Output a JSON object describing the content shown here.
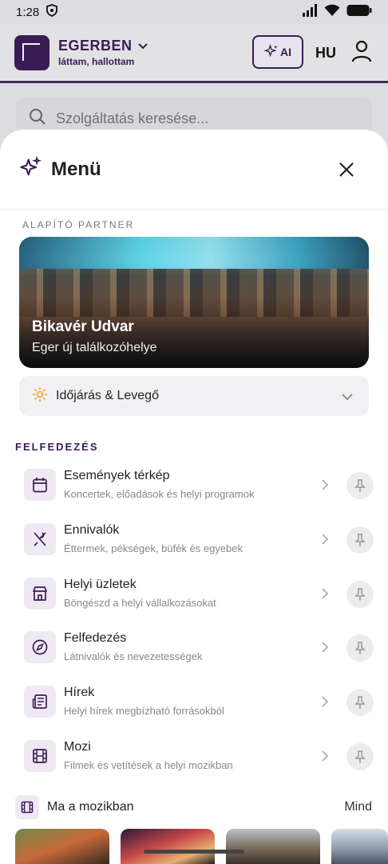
{
  "status_bar": {
    "time": "1:28"
  },
  "app_header": {
    "brand": "EGERBEN",
    "tagline": "láttam, hallottam",
    "ai_label": "AI",
    "lang": "HU"
  },
  "search": {
    "placeholder": "Szolgáltatás keresése..."
  },
  "menu": {
    "title": "Menü",
    "partner_caption": "ALAPÍTÓ PARTNER",
    "partner": {
      "name": "Bikavér Udvar",
      "subtitle": "Eger új találkozóhelye"
    },
    "weather_label": "Időjárás & Levegő",
    "explore_title": "FELFEDEZÉS",
    "items": [
      {
        "title": "Események térkép",
        "subtitle": "Koncertek, előadások és helyi programok",
        "icon": "calendar-icon"
      },
      {
        "title": "Ennivalók",
        "subtitle": "Éttermek, pékségek, büfék és egyebek",
        "icon": "utensils-icon"
      },
      {
        "title": "Helyi üzletek",
        "subtitle": "Böngészd a helyi vállalkozásokat",
        "icon": "store-icon"
      },
      {
        "title": "Felfedezés",
        "subtitle": "Látnivalók és nevezetességek",
        "icon": "compass-icon"
      },
      {
        "title": "Hírek",
        "subtitle": "Helyi hírek megbízható forrásokból",
        "icon": "newspaper-icon"
      },
      {
        "title": "Mozi",
        "subtitle": "Filmek és vetítések a helyi mozikban",
        "icon": "film-icon"
      }
    ],
    "cinema": {
      "label": "Ma a mozikban",
      "all_label": "Mind"
    }
  },
  "colors": {
    "brand": "#3a1c56",
    "accent": "#f0a020"
  }
}
